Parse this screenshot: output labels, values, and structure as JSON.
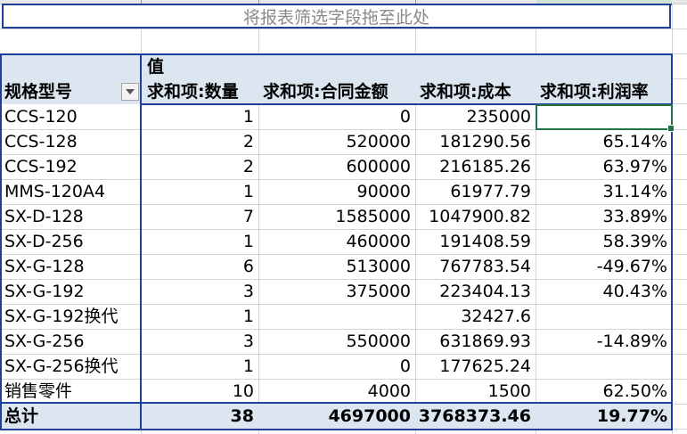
{
  "filter_area": {
    "hint": "将报表筛选字段拖至此处"
  },
  "pivot": {
    "values_caption": "值",
    "row_field_label": "规格型号",
    "column_headers": [
      "求和项:数量",
      "求和项:合同金额",
      "求和项:成本",
      "求和项:利润率"
    ],
    "rows": [
      {
        "label": "CCS-120",
        "qty": "1",
        "amount": "0",
        "cost": "235000",
        "margin": ""
      },
      {
        "label": "CCS-128",
        "qty": "2",
        "amount": "520000",
        "cost": "181290.56",
        "margin": "65.14%"
      },
      {
        "label": "CCS-192",
        "qty": "2",
        "amount": "600000",
        "cost": "216185.26",
        "margin": "63.97%"
      },
      {
        "label": "MMS-120A4",
        "qty": "1",
        "amount": "90000",
        "cost": "61977.79",
        "margin": "31.14%"
      },
      {
        "label": "SX-D-128",
        "qty": "7",
        "amount": "1585000",
        "cost": "1047900.82",
        "margin": "33.89%"
      },
      {
        "label": "SX-D-256",
        "qty": "1",
        "amount": "460000",
        "cost": "191408.59",
        "margin": "58.39%"
      },
      {
        "label": "SX-G-128",
        "qty": "6",
        "amount": "513000",
        "cost": "767783.54",
        "margin": "-49.67%"
      },
      {
        "label": "SX-G-192",
        "qty": "3",
        "amount": "375000",
        "cost": "223404.13",
        "margin": "40.43%"
      },
      {
        "label": "SX-G-192换代",
        "qty": "1",
        "amount": "",
        "cost": "32427.6",
        "margin": ""
      },
      {
        "label": "SX-G-256",
        "qty": "3",
        "amount": "550000",
        "cost": "631869.93",
        "margin": "-14.89%"
      },
      {
        "label": "SX-G-256换代",
        "qty": "1",
        "amount": "0",
        "cost": "177625.24",
        "margin": ""
      },
      {
        "label": "销售零件",
        "qty": "10",
        "amount": "4000",
        "cost": "1500",
        "margin": "62.50%"
      }
    ],
    "total": {
      "label": "总计",
      "qty": "38",
      "amount": "4697000",
      "cost": "3768373.46",
      "margin": "19.77%"
    }
  },
  "colors": {
    "pivot_border": "#203f9a",
    "header_fill": "#dce6f1",
    "active_cell": "#217346",
    "hint_text": "#8a8a8a"
  }
}
